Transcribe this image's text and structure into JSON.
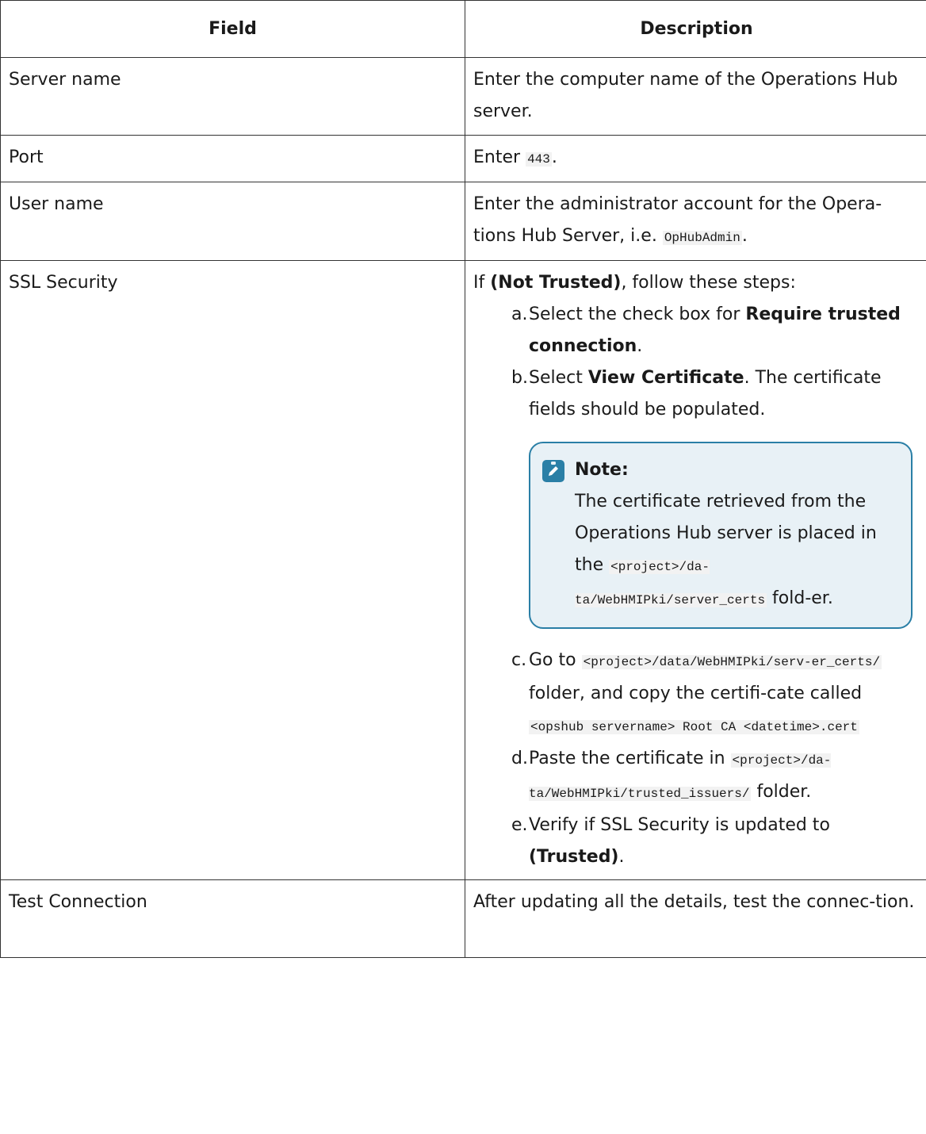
{
  "table": {
    "headers": {
      "field": "Field",
      "description": "Description"
    },
    "rows": {
      "server": {
        "field": "Server name",
        "description": "Enter the computer name of the Operations Hub server."
      },
      "port": {
        "field": "Port",
        "desc_prefix": "Enter",
        "desc_code": "443",
        "desc_suffix": "."
      },
      "user": {
        "field": "User name",
        "desc_prefix": "Enter the administrator account for the Opera-tions Hub Server, i.e.",
        "desc_code": "OpHubAdmin",
        "desc_suffix": "."
      },
      "ssl": {
        "field": "SSL Security",
        "intro_prefix": "If",
        "intro_bold": "(Not Trusted)",
        "intro_suffix": ", follow these steps:",
        "step_a": {
          "marker": "a.",
          "prefix": "Select the check box for",
          "bold": "Require trusted connection",
          "suffix": "."
        },
        "step_b": {
          "marker": "b.",
          "prefix": "Select",
          "bold": "View Certificate",
          "suffix": ". The certificate fields should be populated."
        },
        "note": {
          "title": "Note:",
          "text_prefix": "The certificate retrieved from the Operations Hub server is placed in the",
          "code": "<project>/da-ta/WebHMIPki/server_certs",
          "text_suffix": "fold-er."
        },
        "step_c": {
          "marker": "c.",
          "prefix": "Go to",
          "code1": "<project>/data/WebHMIPki/serv-er_certs/",
          "middle": "folder, and copy the certifi-cate called",
          "code2": "<opshub servername> Root CA <datetime>.cert"
        },
        "step_d": {
          "marker": "d.",
          "prefix": "Paste the certificate in",
          "code": "<project>/da-ta/WebHMIPki/trusted_issuers/",
          "suffix": "folder."
        },
        "step_e": {
          "marker": "e.",
          "prefix": "Verify if SSL Security is updated to",
          "bold": "(Trusted)",
          "suffix": "."
        }
      },
      "test": {
        "field": "Test Connection",
        "description": "After updating all the details, test the connec-tion."
      }
    }
  },
  "icons": {
    "note": "pencil-note-icon"
  },
  "colors": {
    "note_border": "#2a7fa6",
    "note_background": "#e8f1f6"
  }
}
